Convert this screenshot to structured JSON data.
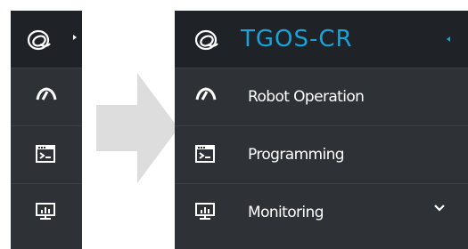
{
  "brand": {
    "title": "TGOS-CR"
  },
  "menu": {
    "items": [
      {
        "label": "Robot Operation",
        "icon": "speedometer-icon"
      },
      {
        "label": "Programming",
        "icon": "terminal-window-icon"
      },
      {
        "label": "Monitoring",
        "icon": "monitor-chart-icon"
      }
    ]
  },
  "colors": {
    "sidebar_bg": "#2e3236",
    "brand_bg": "#1f2226",
    "accent": "#1aa3d8",
    "arrow": "#dddddd"
  }
}
